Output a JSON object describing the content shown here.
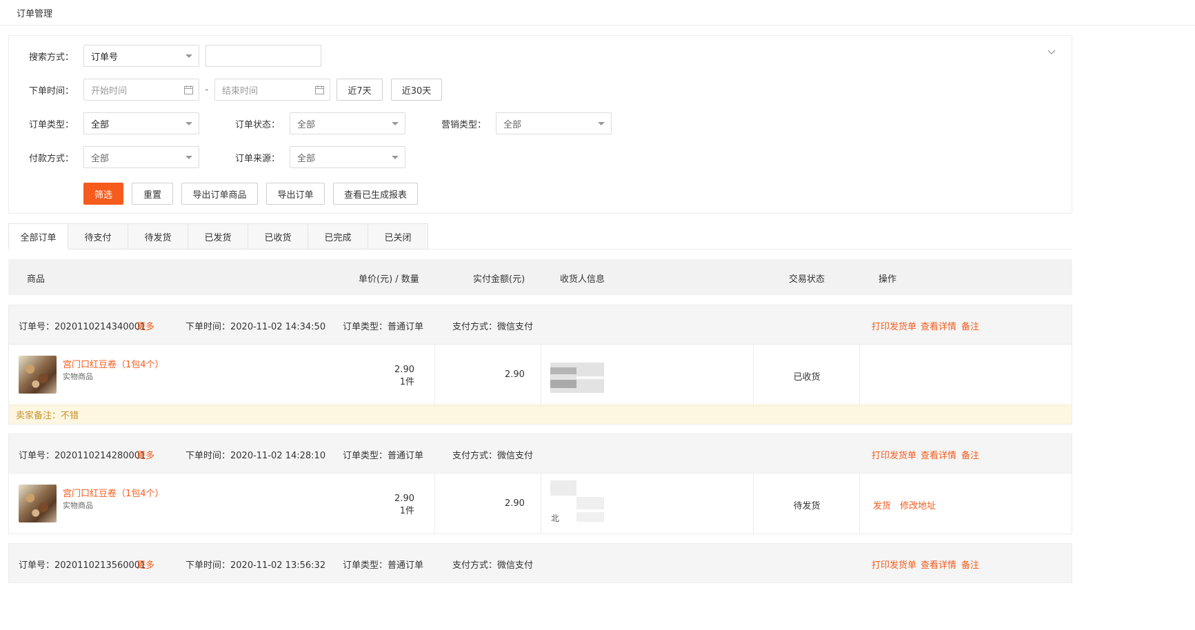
{
  "page": {
    "title": "订单管理"
  },
  "filters": {
    "search_label": "搜索方式：",
    "search_type": "订单号",
    "search_value": "",
    "time_label": "下单时间：",
    "start_placeholder": "开始时间",
    "end_placeholder": "结束时间",
    "range_sep": "-",
    "btn_7d": "近7天",
    "btn_30d": "近30天",
    "order_type_label": "订单类型：",
    "order_type": "全部",
    "order_status_label": "订单状态：",
    "order_status": "全部",
    "marketing_type_label": "营销类型：",
    "marketing_type": "全部",
    "pay_method_label": "付款方式：",
    "pay_method": "全部",
    "order_source_label": "订单来源：",
    "order_source": "全部",
    "btn_filter": "筛选",
    "btn_reset": "重置",
    "btn_export_goods": "导出订单商品",
    "btn_export_orders": "导出订单",
    "btn_view_reports": "查看已生成报表"
  },
  "tabs": [
    "全部订单",
    "待支付",
    "待发货",
    "已发货",
    "已收货",
    "已完成",
    "已关闭"
  ],
  "table_header": {
    "goods": "商品",
    "price_qty": "单价(元) / 数量",
    "paid": "实付金额(元)",
    "receiver": "收货人信息",
    "status": "交易状态",
    "ops": "操作"
  },
  "labels": {
    "order_no": "订单号：",
    "more": "更多",
    "order_time": "下单时间：",
    "order_type": "订单类型：",
    "pay_method": "支付方式："
  },
  "orders": [
    {
      "order_no": "2020110214340001",
      "order_time": "2020-11-02 14:34:50",
      "order_type": "普通订单",
      "pay_method": "微信支付",
      "head_ops": [
        "打印发货单",
        "查看详情",
        "备注"
      ],
      "product_name": "宫门口红豆卷（1包4个）",
      "product_type": "实物商品",
      "unit_price": "2.90",
      "quantity": "1件",
      "paid": "2.90",
      "receiver_text": "",
      "status": "已收货",
      "row_ops": [],
      "seller_note": "卖家备注：不错"
    },
    {
      "order_no": "2020110214280001",
      "order_time": "2020-11-02 14:28:10",
      "order_type": "普通订单",
      "pay_method": "微信支付",
      "head_ops": [
        "打印发货单",
        "查看详情",
        "备注"
      ],
      "product_name": "宫门口红豆卷（1包4个）",
      "product_type": "实物商品",
      "unit_price": "2.90",
      "quantity": "1件",
      "paid": "2.90",
      "receiver_text": "北",
      "status": "待发货",
      "row_ops": [
        "发货",
        "修改地址"
      ]
    },
    {
      "order_no": "2020110213560001",
      "order_time": "2020-11-02 13:56:32",
      "order_type": "普通订单",
      "pay_method": "微信支付",
      "head_ops": [
        "打印发货单",
        "查看详情",
        "备注"
      ]
    }
  ]
}
